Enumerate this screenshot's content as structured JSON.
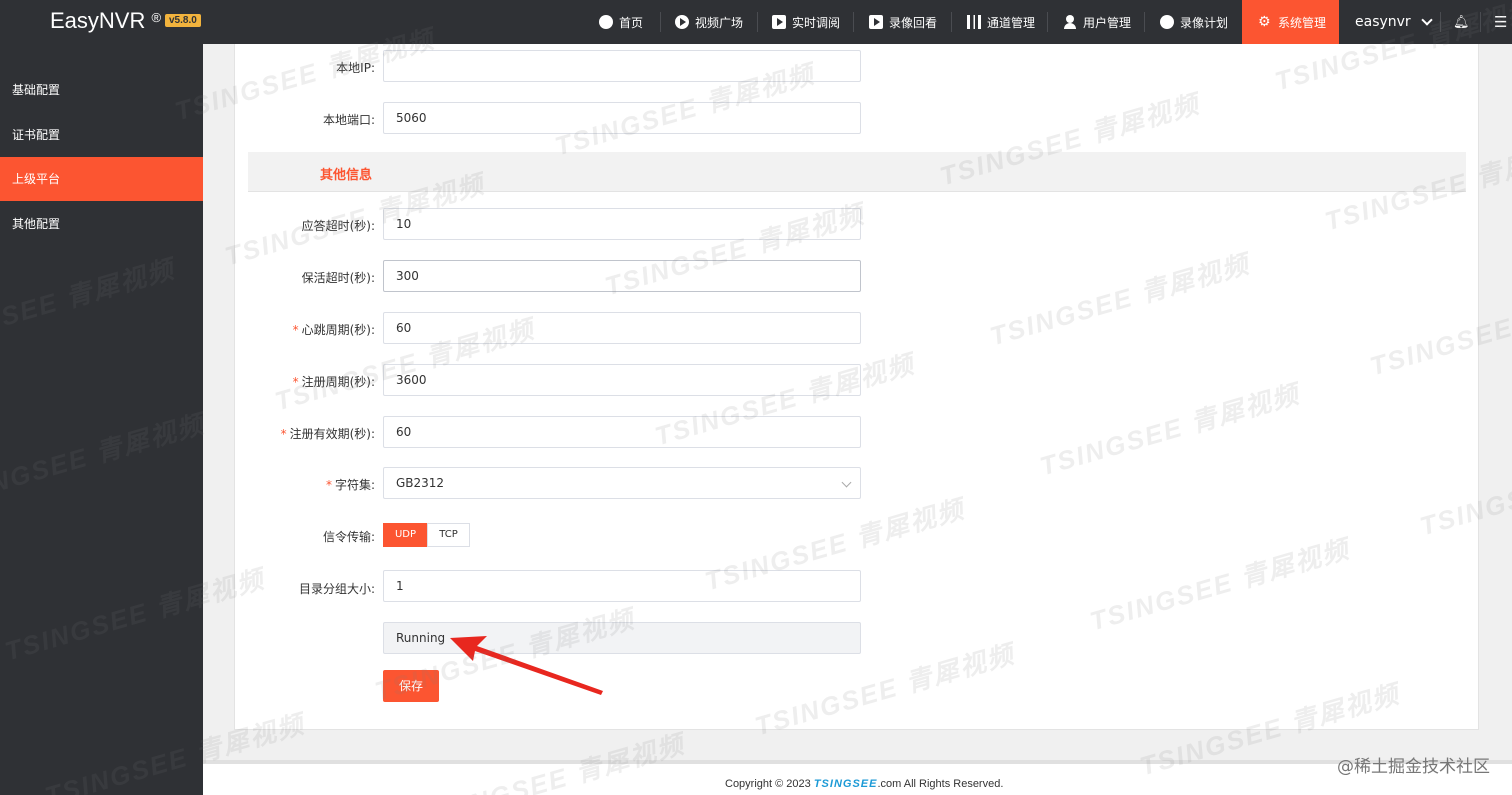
{
  "app": {
    "name": "EasyNVR",
    "reg": "®",
    "version": "v5.8.0"
  },
  "nav": {
    "items": [
      {
        "label": "首页",
        "icon": "dashboard-icon"
      },
      {
        "label": "视频广场",
        "icon": "play-circle-icon"
      },
      {
        "label": "实时调阅",
        "icon": "video-play-icon"
      },
      {
        "label": "录像回看",
        "icon": "video-replay-icon"
      },
      {
        "label": "通道管理",
        "icon": "columns-icon"
      },
      {
        "label": "用户管理",
        "icon": "user-icon"
      },
      {
        "label": "录像计划",
        "icon": "film-reel-icon"
      },
      {
        "label": "系统管理",
        "icon": "gear-icon"
      }
    ],
    "user": "easynvr"
  },
  "sidebar": {
    "items": [
      {
        "label": "基础配置"
      },
      {
        "label": "证书配置"
      },
      {
        "label": "上级平台"
      },
      {
        "label": "其他配置"
      }
    ],
    "active_index": 2
  },
  "form": {
    "local_ip": {
      "label": "本地IP:",
      "value": ""
    },
    "local_port": {
      "label": "本地端口:",
      "value": "5060"
    },
    "section_title": "其他信息",
    "answer_timeout": {
      "label": "应答超时(秒):",
      "value": "10"
    },
    "keepalive_timeout": {
      "label": "保活超时(秒):",
      "value": "300"
    },
    "heartbeat": {
      "label": "心跳周期(秒):",
      "value": "60",
      "required": "*"
    },
    "register_period": {
      "label": "注册周期(秒):",
      "value": "3600",
      "required": "*"
    },
    "register_valid": {
      "label": "注册有效期(秒):",
      "value": "60",
      "required": "*"
    },
    "charset": {
      "label": "字符集:",
      "value": "GB2312",
      "required": "*"
    },
    "transport": {
      "label": "信令传输:",
      "options": [
        "UDP",
        "TCP"
      ],
      "selected": "UDP"
    },
    "catalog_group": {
      "label": "目录分组大小:",
      "value": "1"
    },
    "status": {
      "value": "Running"
    },
    "save_label": "保存"
  },
  "footer": {
    "copyright_prefix": "Copyright © 2023 ",
    "brand": "TSINGSEE",
    "copyright_suffix": ".com All Rights Reserved."
  },
  "watermark": {
    "text": "TSINGSEE 青犀视频",
    "corner": "@稀土掘金技术社区"
  },
  "colors": {
    "accent": "#fc5531",
    "dark": "#2f3135",
    "version_badge": "#f2b33d"
  }
}
